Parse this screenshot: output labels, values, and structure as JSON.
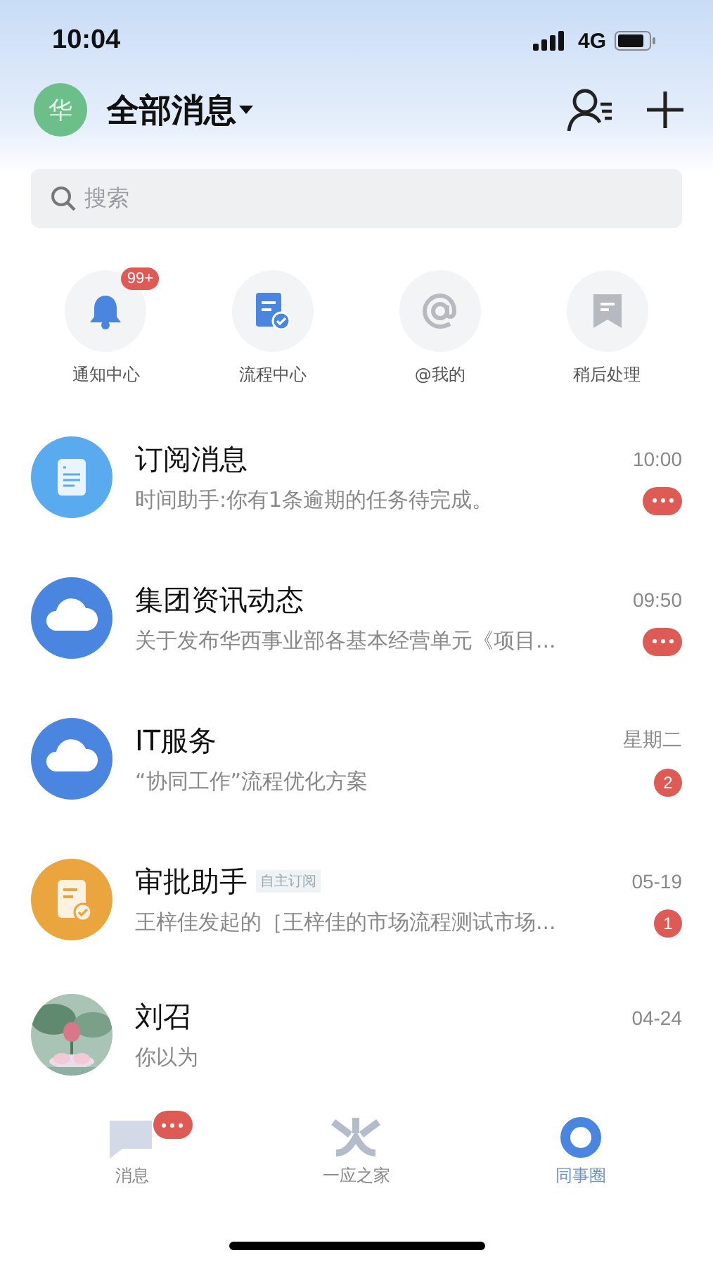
{
  "status_bar": {
    "time": "10:04",
    "network": "4G"
  },
  "header": {
    "avatar": "华",
    "title": "全部消息"
  },
  "search": {
    "placeholder": "搜索"
  },
  "shortcuts": [
    {
      "kind": "bell",
      "label": "通知中心",
      "badge": "99+"
    },
    {
      "kind": "flow",
      "label": "流程中心"
    },
    {
      "kind": "at",
      "label": "@我的"
    },
    {
      "kind": "bookmark",
      "label": "稍后处理"
    }
  ],
  "conversations": [
    {
      "kind": "doc",
      "name": "订阅消息",
      "time": "10:00",
      "preview": "时间助手:你有1条逾期的任务待完成。",
      "badge": {
        "kind": "dots"
      }
    },
    {
      "kind": "cloud",
      "name": "集团资讯动态",
      "time": "09:50",
      "preview": "关于发布华西事业部各基本经营单元《项目...",
      "badge": {
        "kind": "dots"
      }
    },
    {
      "kind": "cloud",
      "name": "IT服务",
      "time": "星期二",
      "preview": "“协同工作”流程优化方案",
      "badge": {
        "kind": "count",
        "text": "2"
      }
    },
    {
      "kind": "approval",
      "name": "审批助手",
      "tag": "自主订阅",
      "time": "05-19",
      "preview": "王梓佳发起的［王梓佳的市场流程测试市场...",
      "badge": {
        "kind": "count",
        "text": "1"
      }
    },
    {
      "name": "刘召",
      "time": "04-24",
      "preview": "你以为"
    }
  ],
  "tabs": [
    {
      "kind": "chat",
      "label": "消息",
      "selected": false,
      "badge": {
        "kind": "dots"
      }
    },
    {
      "kind": "home",
      "label": "一应之家",
      "selected": false
    },
    {
      "kind": "ring",
      "label": "同事圈",
      "selected": true
    }
  ]
}
